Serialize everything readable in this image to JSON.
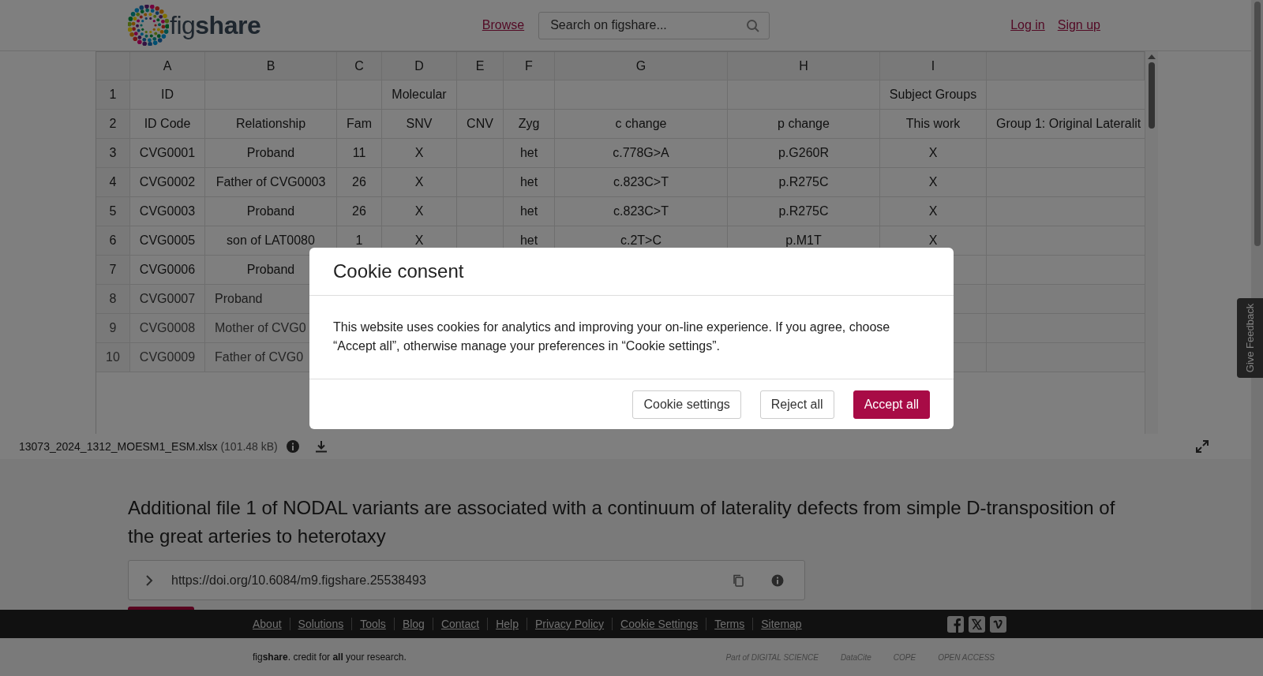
{
  "header": {
    "logo": "fig**share**",
    "browse": "Browse",
    "search": {
      "placeholder": "Search on figshare..."
    },
    "auth_links": [
      "Log in",
      "Sign up"
    ]
  },
  "sheet": {
    "columns": [
      "A",
      "B",
      "C",
      "D",
      "E",
      "F",
      "G",
      "H",
      "I",
      null
    ],
    "rows": [
      {
        "number": "1",
        "blurred": false,
        "cells": [
          "ID",
          null,
          null,
          "Molecular",
          null,
          null,
          null,
          null,
          "Subject Groups",
          null
        ]
      },
      {
        "number": "2",
        "blurred": false,
        "cells": [
          "ID Code",
          "Relationship",
          "Fam",
          "SNV",
          "CNV",
          "Zyg",
          "c change",
          "p change",
          "This work",
          "Group 1: Original Lateralit"
        ]
      },
      {
        "number": "3",
        "blurred": false,
        "cells": [
          "CVG0001",
          "Proband",
          "11",
          "X",
          null,
          "het",
          "c.778G>A",
          "p.G260R",
          "X",
          null
        ]
      },
      {
        "number": "4",
        "blurred": false,
        "cells": [
          "CVG0002",
          "Father of CVG0003",
          "26",
          "X",
          null,
          "het",
          "c.823C>T",
          "p.R275C",
          "X",
          null
        ]
      },
      {
        "number": "5",
        "blurred": false,
        "cells": [
          "CVG0003",
          "Proband",
          "26",
          "X",
          null,
          "het",
          "c.823C>T",
          "p.R275C",
          "X",
          null
        ]
      },
      {
        "number": "6",
        "blurred": false,
        "cells": [
          "CVG0005",
          "son of LAT0080",
          "1",
          "X",
          null,
          "het",
          "c.2T>C",
          "p.M1T",
          "X",
          null
        ]
      },
      {
        "number": "7",
        "blurred": false,
        "cells": [
          "CVG0006",
          "Proband",
          null,
          null,
          null,
          null,
          null,
          null,
          null,
          null
        ]
      },
      {
        "number": "8",
        "blurred": true,
        "cells": [
          "CVG0007",
          "Proband",
          null,
          null,
          null,
          null,
          null,
          null,
          null,
          null
        ]
      },
      {
        "number": "9",
        "blurred": true,
        "cells": [
          "CVG0008",
          "Mother of CVG0",
          null,
          null,
          null,
          null,
          null,
          null,
          null,
          null
        ]
      },
      {
        "number": "10",
        "blurred": true,
        "cells": [
          "CVG0009",
          "Father of CVG0",
          null,
          null,
          null,
          null,
          null,
          null,
          null,
          null
        ]
      }
    ]
  },
  "file": {
    "name": "13073_2024_1312_MOESM1_ESM.xlsx",
    "size": "(101.48 kB)"
  },
  "title": "Additional file 1 of NODAL variants are associated with a continuum of laterality defects from simple D-transposition of the great arteries to heterotaxy",
  "doi": "https://doi.org/10.6084/m9.figshare.25538493",
  "feedback": "Give Feedback",
  "cookie_dialog": {
    "title": "Cookie consent",
    "text": "This website uses cookies for analytics and improving your on-line experience. If you agree, choose “Accept all”, otherwise manage your preferences in “Cookie settings”.",
    "buttons": [
      {
        "label": "Cookie settings",
        "kind": "plain"
      },
      {
        "label": "Reject all",
        "kind": "plain"
      },
      {
        "label": "Accept all",
        "kind": "primary"
      }
    ]
  },
  "footer": {
    "links": [
      "About",
      "Solutions",
      "Tools",
      "Blog",
      "Contact",
      "Help",
      "Privacy Policy",
      "Cookie Settings",
      "Terms",
      "Sitemap"
    ],
    "tagline": "fig**share**. credit for **all** your research.",
    "partners": [
      "Part of DIGITAL SCIENCE",
      "DataCite",
      "COPE",
      "OPEN ACCESS"
    ]
  }
}
